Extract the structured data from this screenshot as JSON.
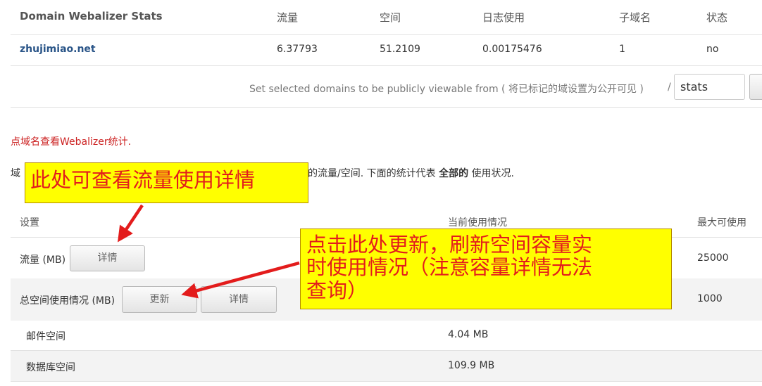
{
  "stats_table": {
    "headers": [
      "Domain Webalizer Stats",
      "流量",
      "空间",
      "日志使用",
      "子域名",
      "状态"
    ],
    "row": {
      "domain": "zhujimiao.net",
      "traffic": "6.37793",
      "space": "51.2109",
      "log_usage": "0.00175476",
      "subdomains": "1",
      "status": "no"
    }
  },
  "public_view": {
    "label": "Set selected domains to be publicly viewable from ( 将已标记的域设置为公开可见 )",
    "slash": "/",
    "value": "stats"
  },
  "hint_text": "点域名查看Webalizer统计.",
  "summary": {
    "prefix": "域",
    "middle": "的流量/空间. 下面的统计代表",
    "emphasis": "全部的",
    "suffix": "使用状况."
  },
  "usage_table": {
    "headers": [
      "设置",
      "当前使用情况",
      "最大可使用"
    ],
    "rows": [
      {
        "label": "流量 (MB)",
        "max": "25000"
      },
      {
        "label": "总空间使用情况 (MB)",
        "max": "1000"
      },
      {
        "label": "邮件空间",
        "current": "4.04 MB"
      },
      {
        "label": "数据库空间",
        "current": "109.9 MB"
      }
    ],
    "details_label": "详情",
    "update_label": "更新"
  },
  "annotations": {
    "callout_traffic": "此处可查看流量使用详情",
    "callout_update_lines": [
      "点击此处更新，刷新空间容量实",
      "时使用情况（注意容量详情无法",
      "查询）"
    ]
  },
  "colors": {
    "callout_fill": "#ffff00",
    "callout_text": "#e31c1c",
    "arrow": "#e31c1c",
    "link": "#2a5588",
    "hint": "#cc2222"
  }
}
